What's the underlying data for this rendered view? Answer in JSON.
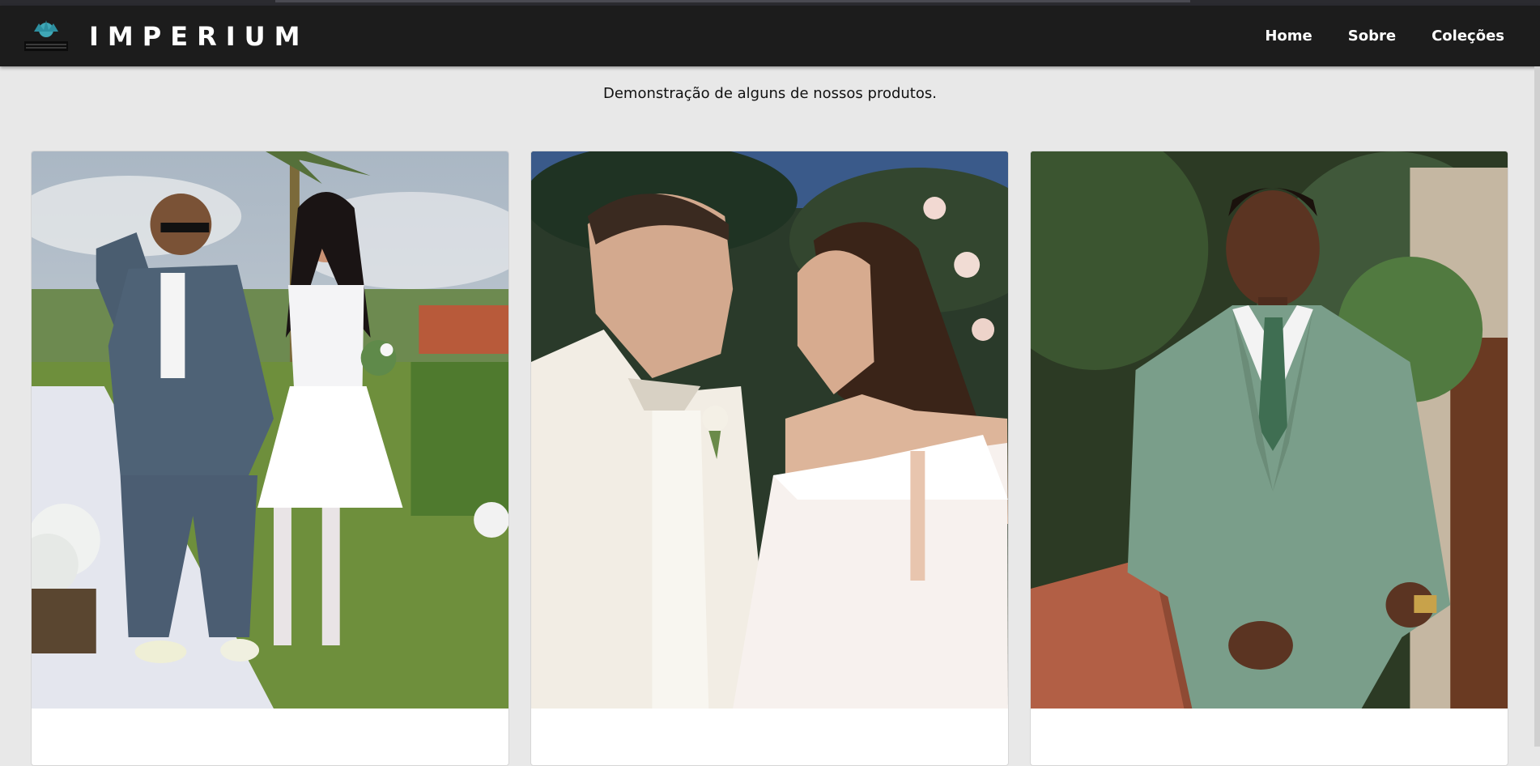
{
  "brand": {
    "name": "IMPERIUM",
    "logo_icon": "crown-logo-icon"
  },
  "nav": {
    "items": [
      {
        "label": "Home"
      },
      {
        "label": "Sobre"
      },
      {
        "label": "Coleções"
      }
    ]
  },
  "intro": {
    "text": "Demonstração de alguns de nossos produtos."
  },
  "products": [
    {
      "image": "wedding couple photo — groom in grey suit, bride in short white dress"
    },
    {
      "image": "wedding couple photo — groom in white tuxedo, bride in white gown"
    },
    {
      "image": "man in green suit with tie leaning on a ledge"
    }
  ],
  "colors": {
    "navbar_bg": "#1c1c1c",
    "page_bg": "#e8e8e8",
    "nav_text": "#ffffff"
  }
}
